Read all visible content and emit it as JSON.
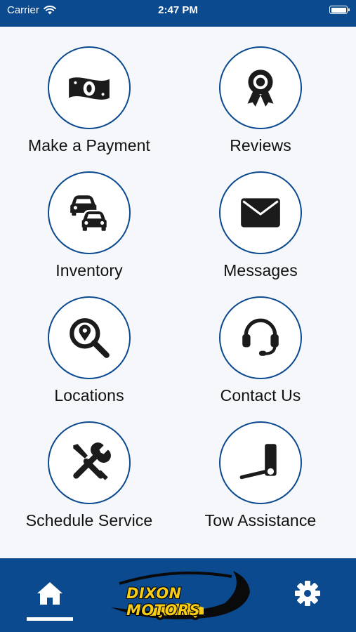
{
  "status_bar": {
    "carrier": "Carrier",
    "time": "2:47 PM"
  },
  "tiles": [
    {
      "label": "Make a Payment",
      "icon": "money-icon"
    },
    {
      "label": "Reviews",
      "icon": "award-ribbon-icon"
    },
    {
      "label": "Inventory",
      "icon": "cars-icon"
    },
    {
      "label": "Messages",
      "icon": "envelope-icon"
    },
    {
      "label": "Locations",
      "icon": "search-location-icon"
    },
    {
      "label": "Contact Us",
      "icon": "headset-icon"
    },
    {
      "label": "Schedule Service",
      "icon": "tools-icon"
    },
    {
      "label": "Tow Assistance",
      "icon": "tow-icon"
    }
  ],
  "bottom_bar": {
    "logo_text": "DIXON MOTORS",
    "home_icon": "home-icon",
    "settings_icon": "gear-icon"
  },
  "colors": {
    "brand_blue": "#0b4a8f",
    "logo_yellow": "#f7cc16",
    "background": "#f5f7fa"
  }
}
